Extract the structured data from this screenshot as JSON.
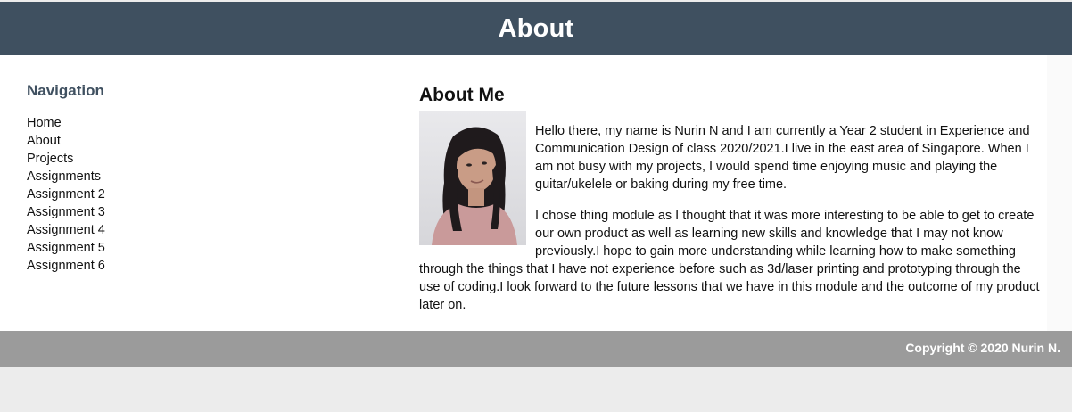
{
  "header": {
    "title": "About"
  },
  "navigation": {
    "heading": "Navigation",
    "items": [
      "Home",
      "About",
      "Projects",
      "Assignments",
      "Assignment 2",
      "Assignment 3",
      "Assignment 4",
      "Assignment 5",
      "Assignment 6"
    ]
  },
  "main": {
    "heading": "About Me",
    "photo_alt": "portrait photo",
    "paragraphs": [
      "Hello there, my name is Nurin N and I am currently a Year 2 student in Experience and Communication Design of class 2020/2021.I live in the east area of Singapore. When I am not busy with my projects, I would spend time enjoying music and playing the guitar/ukelele or baking during my free time.",
      "I chose thing module as I thought that it was more interesting to be able to get to create our own product as well as learning new skills and knowledge that I may not know previously.I hope to gain more understanding while learning how to make something through the things that I have not experience before such as 3d/laser printing and prototyping through the use of coding.I look forward to the future lessons that we have in this module and the outcome of my product later on."
    ]
  },
  "footer": {
    "copyright": "Copyright © 2020 Nurin N."
  },
  "colors": {
    "header_bg": "#3f5060",
    "nav_heading": "#3f5060",
    "footer_bg": "#9b9b9b",
    "page_bg": "#ececec"
  }
}
